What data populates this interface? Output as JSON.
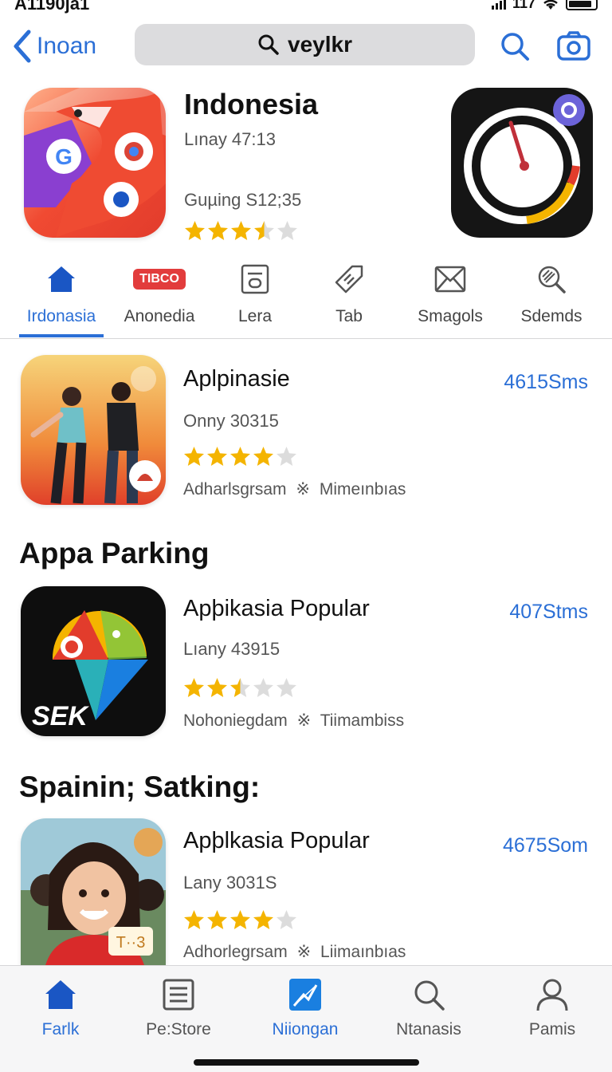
{
  "status_bar": {
    "time": "A1190ja1",
    "network": "117"
  },
  "navbar": {
    "back_label": "Inoan",
    "search_text": "veylkr"
  },
  "hero": {
    "title": "Indonesia",
    "subtitle": "Lınay 47:13",
    "subtitle2": "Guµing S12;35",
    "rating": 3.5
  },
  "categories": [
    {
      "label": "Irdonasia",
      "icon": "home-icon",
      "active": true
    },
    {
      "label": "Anonedia",
      "icon": "tbco-badge",
      "badge": "TIBCO"
    },
    {
      "label": "Lera",
      "icon": "frame-icon"
    },
    {
      "label": "Tab",
      "icon": "tag-icon"
    },
    {
      "label": "Smagols",
      "icon": "envelope-icon"
    },
    {
      "label": "Sdemds",
      "icon": "magnifier-icon"
    }
  ],
  "rows": [
    {
      "name": "Aplpinasie",
      "sub": "Onny 30315",
      "meta": "Adharlsgrsam",
      "meta2": "Mimeınbıas",
      "size": "4615Sms",
      "rating": 4
    },
    {
      "name": "Apþikasia Popular",
      "sub": "Lıany 43915",
      "meta": "Nohoniegdam",
      "meta2": "Tiimambiss",
      "size": "407Stms",
      "rating": 2.5
    },
    {
      "name": "Apþlkasia Popular",
      "sub": "Lany 3031S",
      "meta": "Adhorlegrsam",
      "meta2": "Liimaınbıas",
      "size": "4675Som",
      "rating": 4
    }
  ],
  "sections": {
    "parking": "Appa Parking",
    "spainin": "Spainin; Satking:"
  },
  "icon_text": {
    "sek": "SEK",
    "t3": "T··3"
  },
  "meta_separator": "※",
  "tabbar": [
    {
      "label": "Farlk",
      "icon": "home-icon",
      "active": true
    },
    {
      "label": "Pe:Store",
      "icon": "list-icon"
    },
    {
      "label": "Niiongan",
      "icon": "chart-icon",
      "active": true
    },
    {
      "label": "Ntanasis",
      "icon": "search-icon"
    },
    {
      "label": "Pamis",
      "icon": "person-icon"
    }
  ],
  "colors": {
    "accent": "#2b6fd6",
    "star": "#f4b400",
    "star_empty": "#dcdcdc"
  }
}
